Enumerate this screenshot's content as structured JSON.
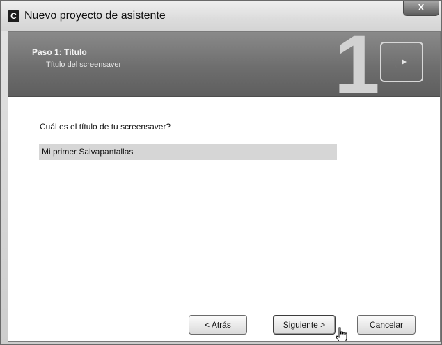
{
  "window": {
    "title": "Nuevo proyecto de asistente",
    "app_icon_glyph": "C",
    "close_glyph": "X"
  },
  "banner": {
    "step_title": "Paso 1: Título",
    "step_subtitle": "Título del screensaver",
    "step_number": "1",
    "logo_icon": "moon-play-icon"
  },
  "content": {
    "question": "Cuál es el título de tu screensaver?",
    "title_value": "Mi primer Salvapantallas"
  },
  "buttons": {
    "back": "< Atrás",
    "next": "Siguiente >",
    "cancel": "Cancelar"
  },
  "colors": {
    "banner_top": "#8a8a8a",
    "banner_bottom": "#5e5e5e",
    "input_bg": "#d6d6d6"
  }
}
